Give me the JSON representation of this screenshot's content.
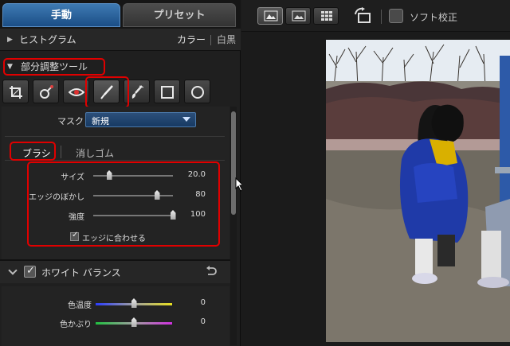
{
  "tabs": {
    "manual": "手動",
    "preset": "プリセット"
  },
  "histogram": {
    "label": "ヒストグラム",
    "color": "カラー",
    "mono": "白黒"
  },
  "partial_tool": {
    "label": "部分調整ツール"
  },
  "mask": {
    "label": "マスク",
    "value": "新規"
  },
  "brush_tabs": {
    "brush": "ブラシ",
    "eraser": "消しゴム"
  },
  "sliders": [
    {
      "label": "サイズ",
      "value": "20.0",
      "level": 0.2
    },
    {
      "label": "エッジのぼかし",
      "value": "80",
      "level": 0.8
    },
    {
      "label": "強度",
      "value": "100",
      "level": 1.0
    }
  ],
  "edge_fit": {
    "label": "エッジに合わせる",
    "checked": true
  },
  "white_balance": {
    "label": "ホワイト バランス",
    "checked": true
  },
  "wb_sliders": [
    {
      "label": "色温度",
      "value": "0",
      "level": 0.5
    },
    {
      "label": "色かぶり",
      "value": "0",
      "level": 0.5
    }
  ],
  "toolbar_right": {
    "soft_proof": "ソフト校正"
  },
  "colors": {
    "highlight_red": "#e00000",
    "accent_blue": "#2d5f96"
  }
}
